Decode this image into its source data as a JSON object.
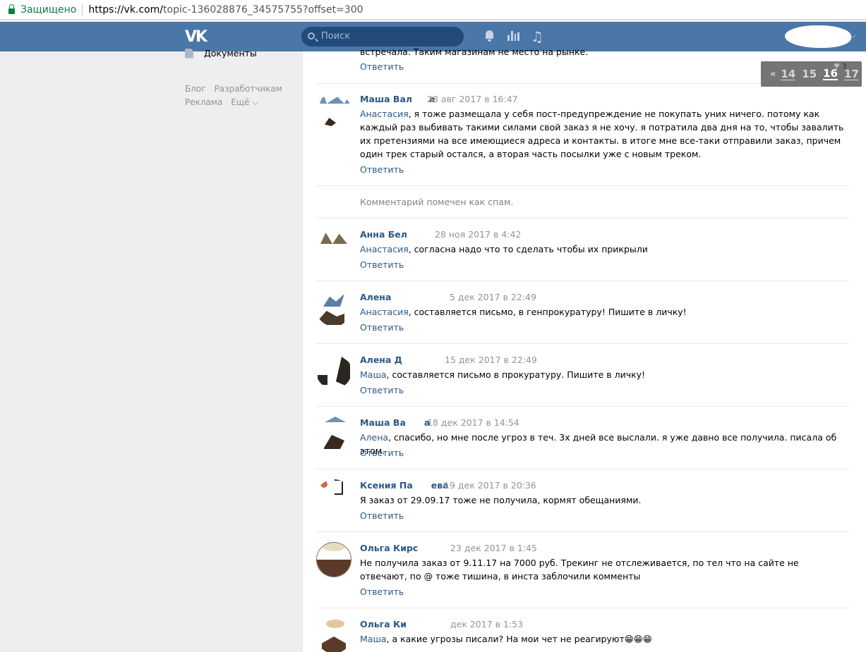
{
  "browser": {
    "secure_label": "Защищено",
    "url_host": "https://vk.com/",
    "url_path": "topic-136028876_34575755?offset=300"
  },
  "header": {
    "logo": "VK",
    "search_placeholder": "Поиск"
  },
  "sidebar": {
    "documents_label": "Документы",
    "footer_links": [
      "Блог",
      "Разработчикам",
      "Реклама",
      "Ещё ⌵"
    ]
  },
  "pager": {
    "prev": "«",
    "pages": [
      "14",
      "15",
      "16",
      "17"
    ],
    "current": "16"
  },
  "top_fragment": {
    "text": "встречала. Таким магазинам не место на рынке.",
    "likes": "3"
  },
  "comments": [
    {
      "author": "Маша Вал",
      "author_tail": "а",
      "date": "28 авг 2017 в 16:47",
      "mention": "Анастасия",
      "text": ", я тоже размещала у себя пост-предупреждение не покупать уних ничего. потому как каждый раз выбивать такими силами свой заказ я не хочу. я потратила два дня на то, чтобы завалить их претензиями на все имеющиеся адреса и контакты. в итоге мне все-таки отправили заказ, причем один трек старый остался, а вторая часть посылки уже с новым треком."
    },
    {
      "spam": "Комментарий помечен как спам."
    },
    {
      "author": "Анна Бел",
      "date": "28 ноя 2017 в 4:42",
      "mention": "Анастасия",
      "text": ", согласна надо что то сделать чтобы их прикрыли"
    },
    {
      "author": "Алена",
      "date": "5 дек 2017 в 22:49",
      "mention": "Анастасия",
      "text": ", составляется письмо, в генпрокуратуру! Пишите в личку!"
    },
    {
      "author": "Алена Д",
      "date": "15 дек 2017 в 22:49",
      "mention": "Маша",
      "text": ", составляется письмо в прокуратуру. Пишите в личку!"
    },
    {
      "author": "Маша Ва",
      "author_tail": "а",
      "date": "18 дек 2017 в 14:54",
      "mention": "Алена",
      "text": ", спасибо, но мне после угроз в теч. 3х дней все выслали. я уже давно все получила. писала об этом."
    },
    {
      "author": "Ксения Па",
      "author_tail": "ева",
      "date": "19 дек 2017 в 20:36",
      "mention": "",
      "text": "Я заказ от 29.09.17 тоже не получила, кормят обещаниями."
    },
    {
      "author": "Ольга Кирс",
      "date": "23 дек 2017 в 1:45",
      "mention": "",
      "text": "Не получила заказ от 9.11.17 на 7000 руб. Трекинг не отслеживается, по тел что на сайте не отвечают, по @ тоже тишина, в инста заблочили комменты"
    },
    {
      "author": "Ольга Ки",
      "date": "дек 2017 в 1:53",
      "mention": "Маша",
      "text": ", а какие угрозы писали? На мои чет не реагируют😁😁😁"
    }
  ],
  "reply_label": "Ответить",
  "colors": {
    "header": "#4a76a8",
    "link": "#2a5885",
    "secure": "#0b8043"
  }
}
